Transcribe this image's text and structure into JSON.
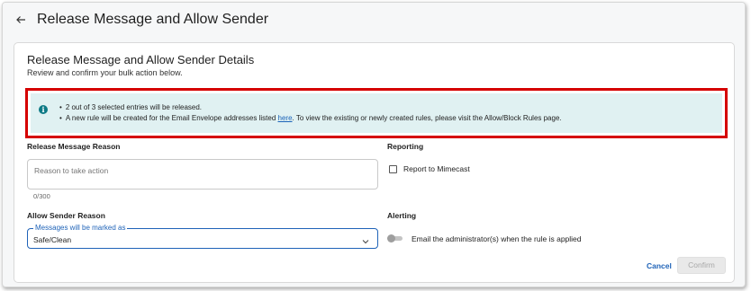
{
  "header": {
    "title": "Release Message and Allow Sender"
  },
  "card": {
    "title": "Release Message and Allow Sender Details",
    "subtitle": "Review and confirm your bulk action below."
  },
  "info": {
    "icon": "info-icon",
    "line1": "2 out of 3 selected entries will be released.",
    "line2_before": "A new rule will be created for the Email Envelope addresses listed ",
    "line2_link": "here",
    "line2_after": ". To view the existing or newly created rules, please visit the Allow/Block Rules page.",
    "highlight_color": "#d50000",
    "background_color": "#e0f1f2"
  },
  "release": {
    "label": "Release Message Reason",
    "placeholder": "Reason to take action",
    "counter": "0/300"
  },
  "allow": {
    "label": "Allow Sender Reason",
    "select_legend": "Messages will be marked as",
    "select_value": "Safe/Clean"
  },
  "reporting": {
    "label": "Reporting",
    "checkbox_label": "Report to Mimecast",
    "checked": false
  },
  "alerting": {
    "label": "Alerting",
    "toggle_label": "Email the administrator(s) when the rule is applied",
    "enabled": false
  },
  "actions": {
    "cancel": "Cancel",
    "confirm": "Confirm"
  },
  "colors": {
    "accent": "#1f63b8",
    "info_icon": "#0d7a86"
  }
}
